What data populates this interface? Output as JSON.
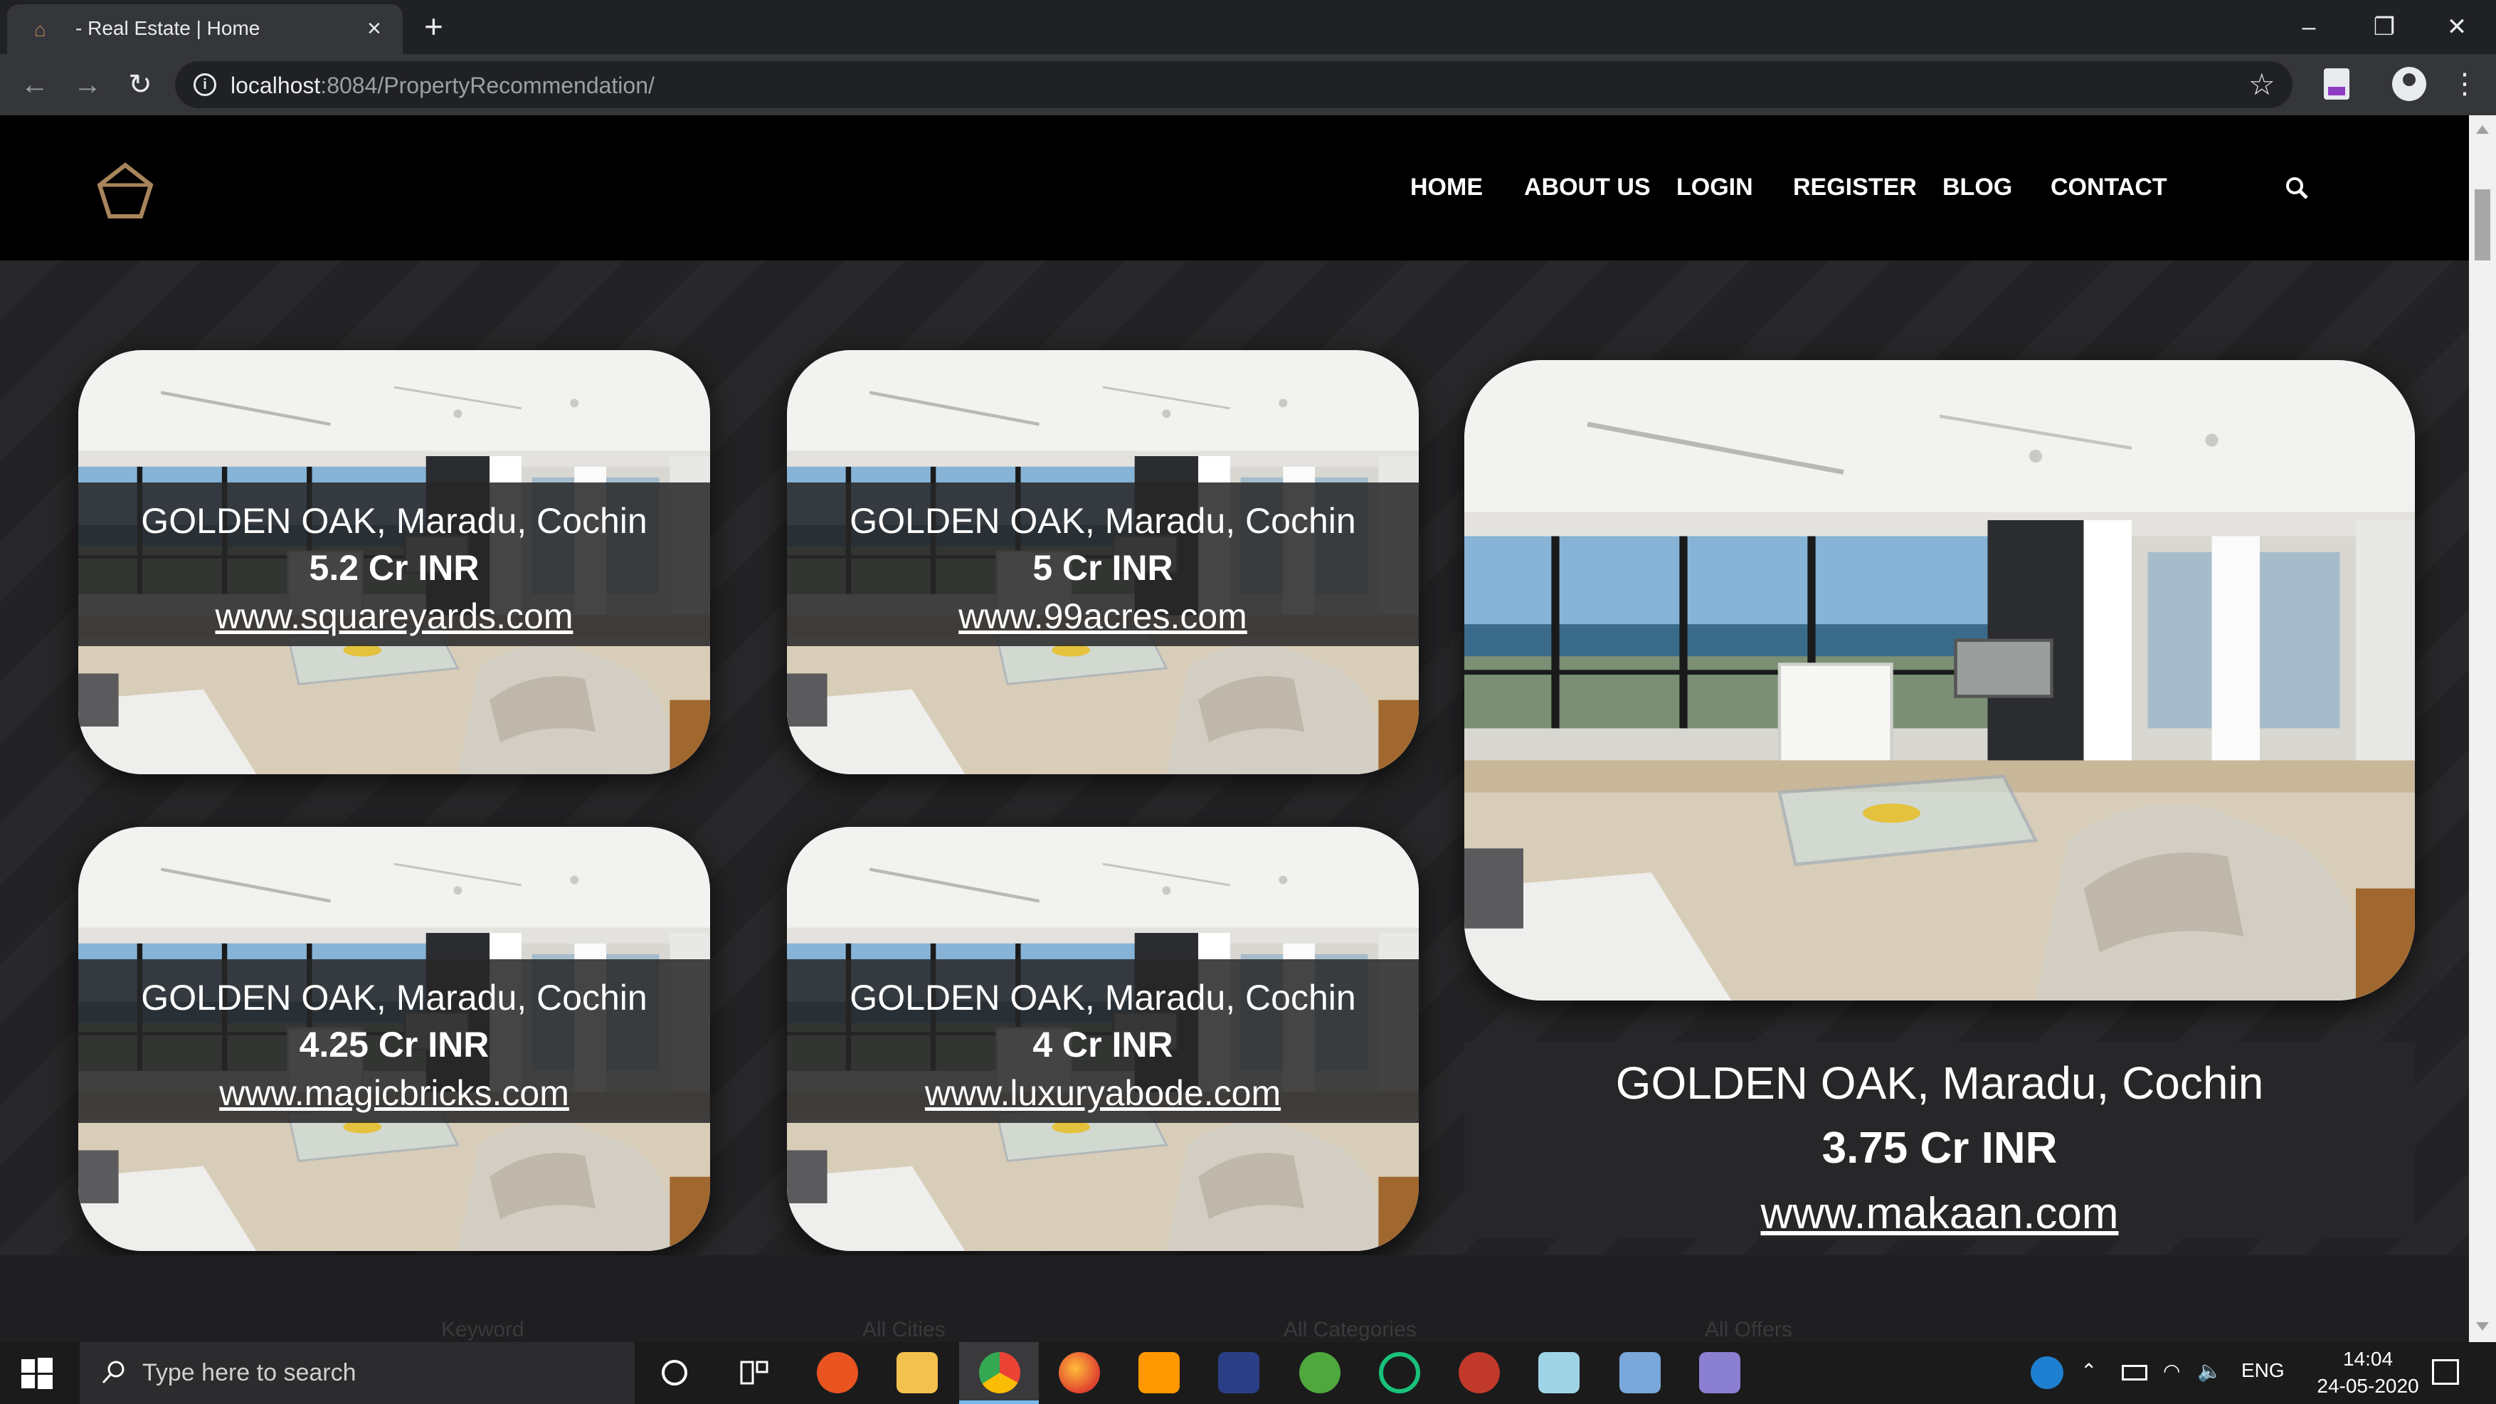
{
  "browser": {
    "tab_title": "- Real Estate | Home",
    "url_host": "localhost",
    "url_path": ":8084/PropertyRecommendation/"
  },
  "nav": {
    "items": [
      "HOME",
      "ABOUT US",
      "LOGIN",
      "REGISTER",
      "BLOG",
      "CONTACT"
    ]
  },
  "listings": [
    {
      "name": "GOLDEN OAK, Maradu, Cochin",
      "price": "5.2 Cr INR",
      "site": "www.squareyards.com"
    },
    {
      "name": "GOLDEN OAK, Maradu, Cochin",
      "price": "5 Cr INR",
      "site": "www.99acres.com"
    },
    {
      "name": "GOLDEN OAK, Maradu, Cochin",
      "price": "4.25 Cr INR",
      "site": "www.magicbricks.com"
    },
    {
      "name": "GOLDEN OAK, Maradu, Cochin",
      "price": "4 Cr INR",
      "site": "www.luxuryabode.com"
    }
  ],
  "featured": {
    "name": "GOLDEN OAK, Maradu, Cochin",
    "price": "3.75 Cr INR",
    "site": "www.makaan.com"
  },
  "filters": [
    "Keyword",
    "All Cities",
    "All Categories",
    "All Offers"
  ],
  "taskbar": {
    "search_placeholder": "Type here to search",
    "language": "ENG",
    "time": "14:04",
    "date": "24-05-2020"
  },
  "colors": {
    "logo_accent": "#a8855c",
    "header_bg": "#000000",
    "page_bg": "#232325"
  }
}
